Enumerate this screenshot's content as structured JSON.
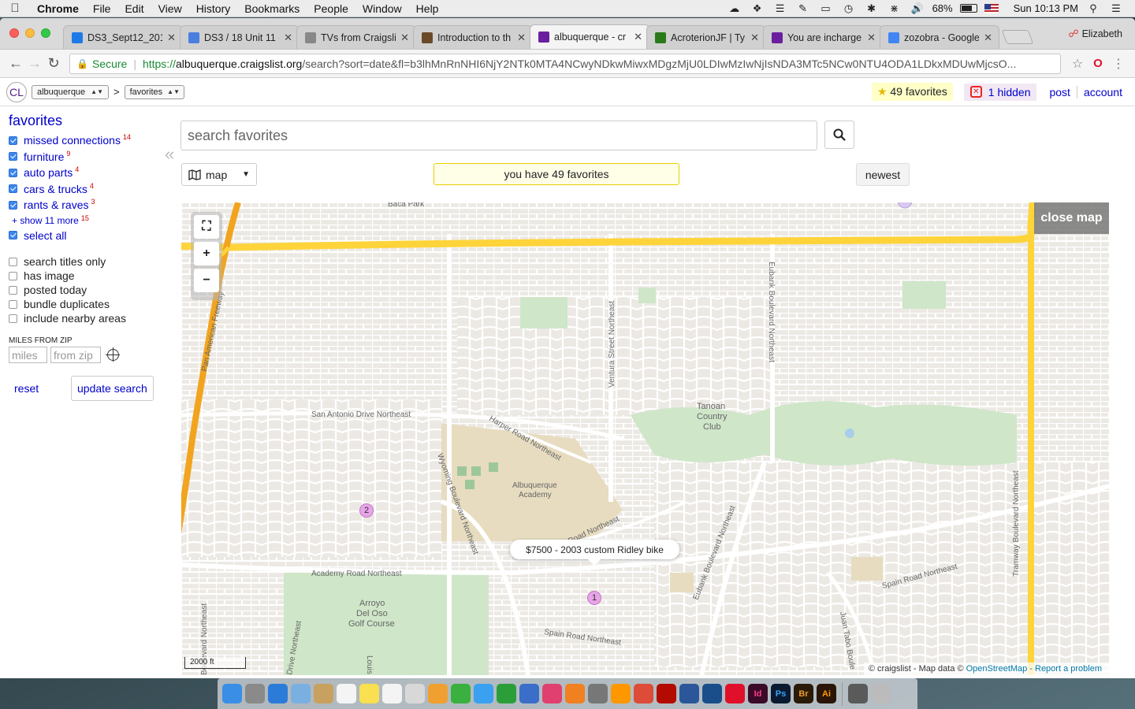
{
  "menubar": {
    "apple_icon": "apple-icon",
    "app": "Chrome",
    "items": [
      "File",
      "Edit",
      "View",
      "History",
      "Bookmarks",
      "People",
      "Window",
      "Help"
    ],
    "battery": "68%",
    "clock": "Sun 10:13 PM"
  },
  "tabs": [
    {
      "title": "DS3_Sept12_2018",
      "icon_color": "#1e7ae8",
      "icon": "dropbox-icon"
    },
    {
      "title": "DS3 / 18 Unit 11 -",
      "icon_color": "#4a7fe0",
      "icon": "docs-icon"
    },
    {
      "title": "TVs from Craigslist",
      "icon_color": "#888888",
      "icon": "page-icon"
    },
    {
      "title": "Introduction to th",
      "icon_color": "#6b4a2a",
      "icon": "book-icon"
    },
    {
      "title": "albuquerque - cr",
      "icon_color": "#6b1fa0",
      "icon": "peace-icon",
      "active": true
    },
    {
      "title": "AcroterionJF | Ty",
      "icon_color": "#2a7a1a",
      "icon": "tk-icon"
    },
    {
      "title": "You are incharge",
      "icon_color": "#6b1fa0",
      "icon": "peace-icon"
    },
    {
      "title": "zozobra - Google",
      "icon_color": "#4285f4",
      "icon": "google-icon"
    }
  ],
  "profile": "Elizabeth",
  "omnibox": {
    "secure_label": "Secure",
    "url_scheme": "https://",
    "url_host": "albuquerque.craigslist.org",
    "url_path": "/search?sort=date&fl=b3lhMnRnNHI6NjY2NTk0MTA4NCwyNDkwMiwxMDgzMjU0LDIwMzIwNjIsNDA3MTc5NCw0NTU4ODA1LDkxMDUwMjcsO..."
  },
  "clheader": {
    "logo": "CL",
    "area": "albuquerque",
    "section": "favorites",
    "favorites_count": "49 favorites",
    "hidden_count": "1 hidden",
    "post": "post",
    "account": "account"
  },
  "sidebar": {
    "title": "favorites",
    "categories": [
      {
        "label": "missed connections",
        "count": "14"
      },
      {
        "label": "furniture",
        "count": "9"
      },
      {
        "label": "auto parts",
        "count": "4"
      },
      {
        "label": "cars & trucks",
        "count": "4"
      },
      {
        "label": "rants & raves",
        "count": "3"
      }
    ],
    "show_more": "+ show 11 more",
    "show_more_count": "15",
    "select_all": "select all",
    "options": [
      "search titles only",
      "has image",
      "posted today",
      "bundle duplicates",
      "include nearby areas"
    ],
    "miles_header": "MILES FROM ZIP",
    "miles_placeholder": "miles",
    "zip_placeholder": "from zip",
    "reset": "reset",
    "update": "update search"
  },
  "main": {
    "search_placeholder": "search favorites",
    "view_mode": "map",
    "favcount": "you have 49 favorites",
    "sort": "newest"
  },
  "map": {
    "close": "close map",
    "popup": "$7500 - 2003 custom Ridley bike",
    "pins": [
      {
        "label": "2"
      },
      {
        "label": "1"
      }
    ],
    "scale": "2000 ft",
    "attrib_prefix": "© craigslist - Map data ©",
    "attrib_osm": "OpenStreetMap",
    "attrib_report": "- Report a problem",
    "labels": {
      "baca": "Baca Park",
      "panam": "Pan American Freeway",
      "ventura": "Ventura Street Northeast",
      "eubank_n": "Eubank Boulevard Northeast",
      "san_antonio": "San Antonio Drive Northeast",
      "tanoan": "Tanoan",
      "tanoan2": "Country",
      "tanoan3": "Club",
      "harper": "Harper Road Northeast",
      "wyoming": "Wyoming Boulevard Northeast",
      "academy_s": "Albuquerque",
      "academy_s2": "Academy",
      "academy_road_ne": "my Road Northeast",
      "academy_road": "Academy Road Northeast",
      "arroyo": "Arroyo",
      "arroyo2": "Del Oso",
      "arroyo3": "Golf Course",
      "spain": "Spain Road Northeast",
      "spain2": "Spain Road Northeast",
      "eubank_s": "Eubank Boulevard Northeast",
      "tramway": "Tramway Boulevard Northeast",
      "juan": "Juan Tabo Boule",
      "drive": "Drive Northeast",
      "louis": "Louis",
      "blvd_left": "Boulevard Northeast"
    }
  },
  "dock": [
    {
      "icon": "finder-icon",
      "color": "#3a8ee6"
    },
    {
      "icon": "launchpad-icon",
      "color": "#8a8a8a"
    },
    {
      "icon": "safari-icon",
      "color": "#2b7bd8"
    },
    {
      "icon": "preview-icon",
      "color": "#7ab0e0"
    },
    {
      "icon": "notes-icon",
      "color": "#c8a060"
    },
    {
      "icon": "calendar-icon",
      "color": "#f4f4f4"
    },
    {
      "icon": "stickies-icon",
      "color": "#f8e050"
    },
    {
      "icon": "reminders-icon",
      "color": "#f4f4f4"
    },
    {
      "icon": "photos-preview-icon",
      "color": "#d8d8d8"
    },
    {
      "icon": "photos-icon",
      "color": "#f0a030"
    },
    {
      "icon": "facetime-icon",
      "color": "#3ab040"
    },
    {
      "icon": "messages-icon",
      "color": "#3aa0f0"
    },
    {
      "icon": "numbers-icon",
      "color": "#2b9e3a"
    },
    {
      "icon": "keynote-icon",
      "color": "#3a6ec8"
    },
    {
      "icon": "itunes-icon",
      "color": "#e04070"
    },
    {
      "icon": "ibooks-icon",
      "color": "#f08020"
    },
    {
      "icon": "system-prefs-icon",
      "color": "#777777"
    },
    {
      "icon": "sublime-icon",
      "color": "#ff9800"
    },
    {
      "icon": "chrome-icon",
      "color": "#dd4b39"
    },
    {
      "icon": "acrobat-icon",
      "color": "#b30b00"
    },
    {
      "icon": "word-icon",
      "color": "#2b579a"
    },
    {
      "icon": "flashcards-icon",
      "color": "#1a4e8a"
    },
    {
      "icon": "opera-icon",
      "color": "#e0102a"
    },
    {
      "icon": "indesign-icon",
      "color": "#3a0a28",
      "text": "Id"
    },
    {
      "icon": "photoshop-icon",
      "color": "#0a1a30",
      "text": "Ps"
    },
    {
      "icon": "bridge-icon",
      "color": "#2a1a08",
      "text": "Br"
    },
    {
      "icon": "illustrator-icon",
      "color": "#2a1608",
      "text": "Ai"
    },
    {
      "icon": "folder-icon",
      "color": "#5a5a5a"
    },
    {
      "icon": "trash-icon",
      "color": "#bbbbbb"
    }
  ]
}
